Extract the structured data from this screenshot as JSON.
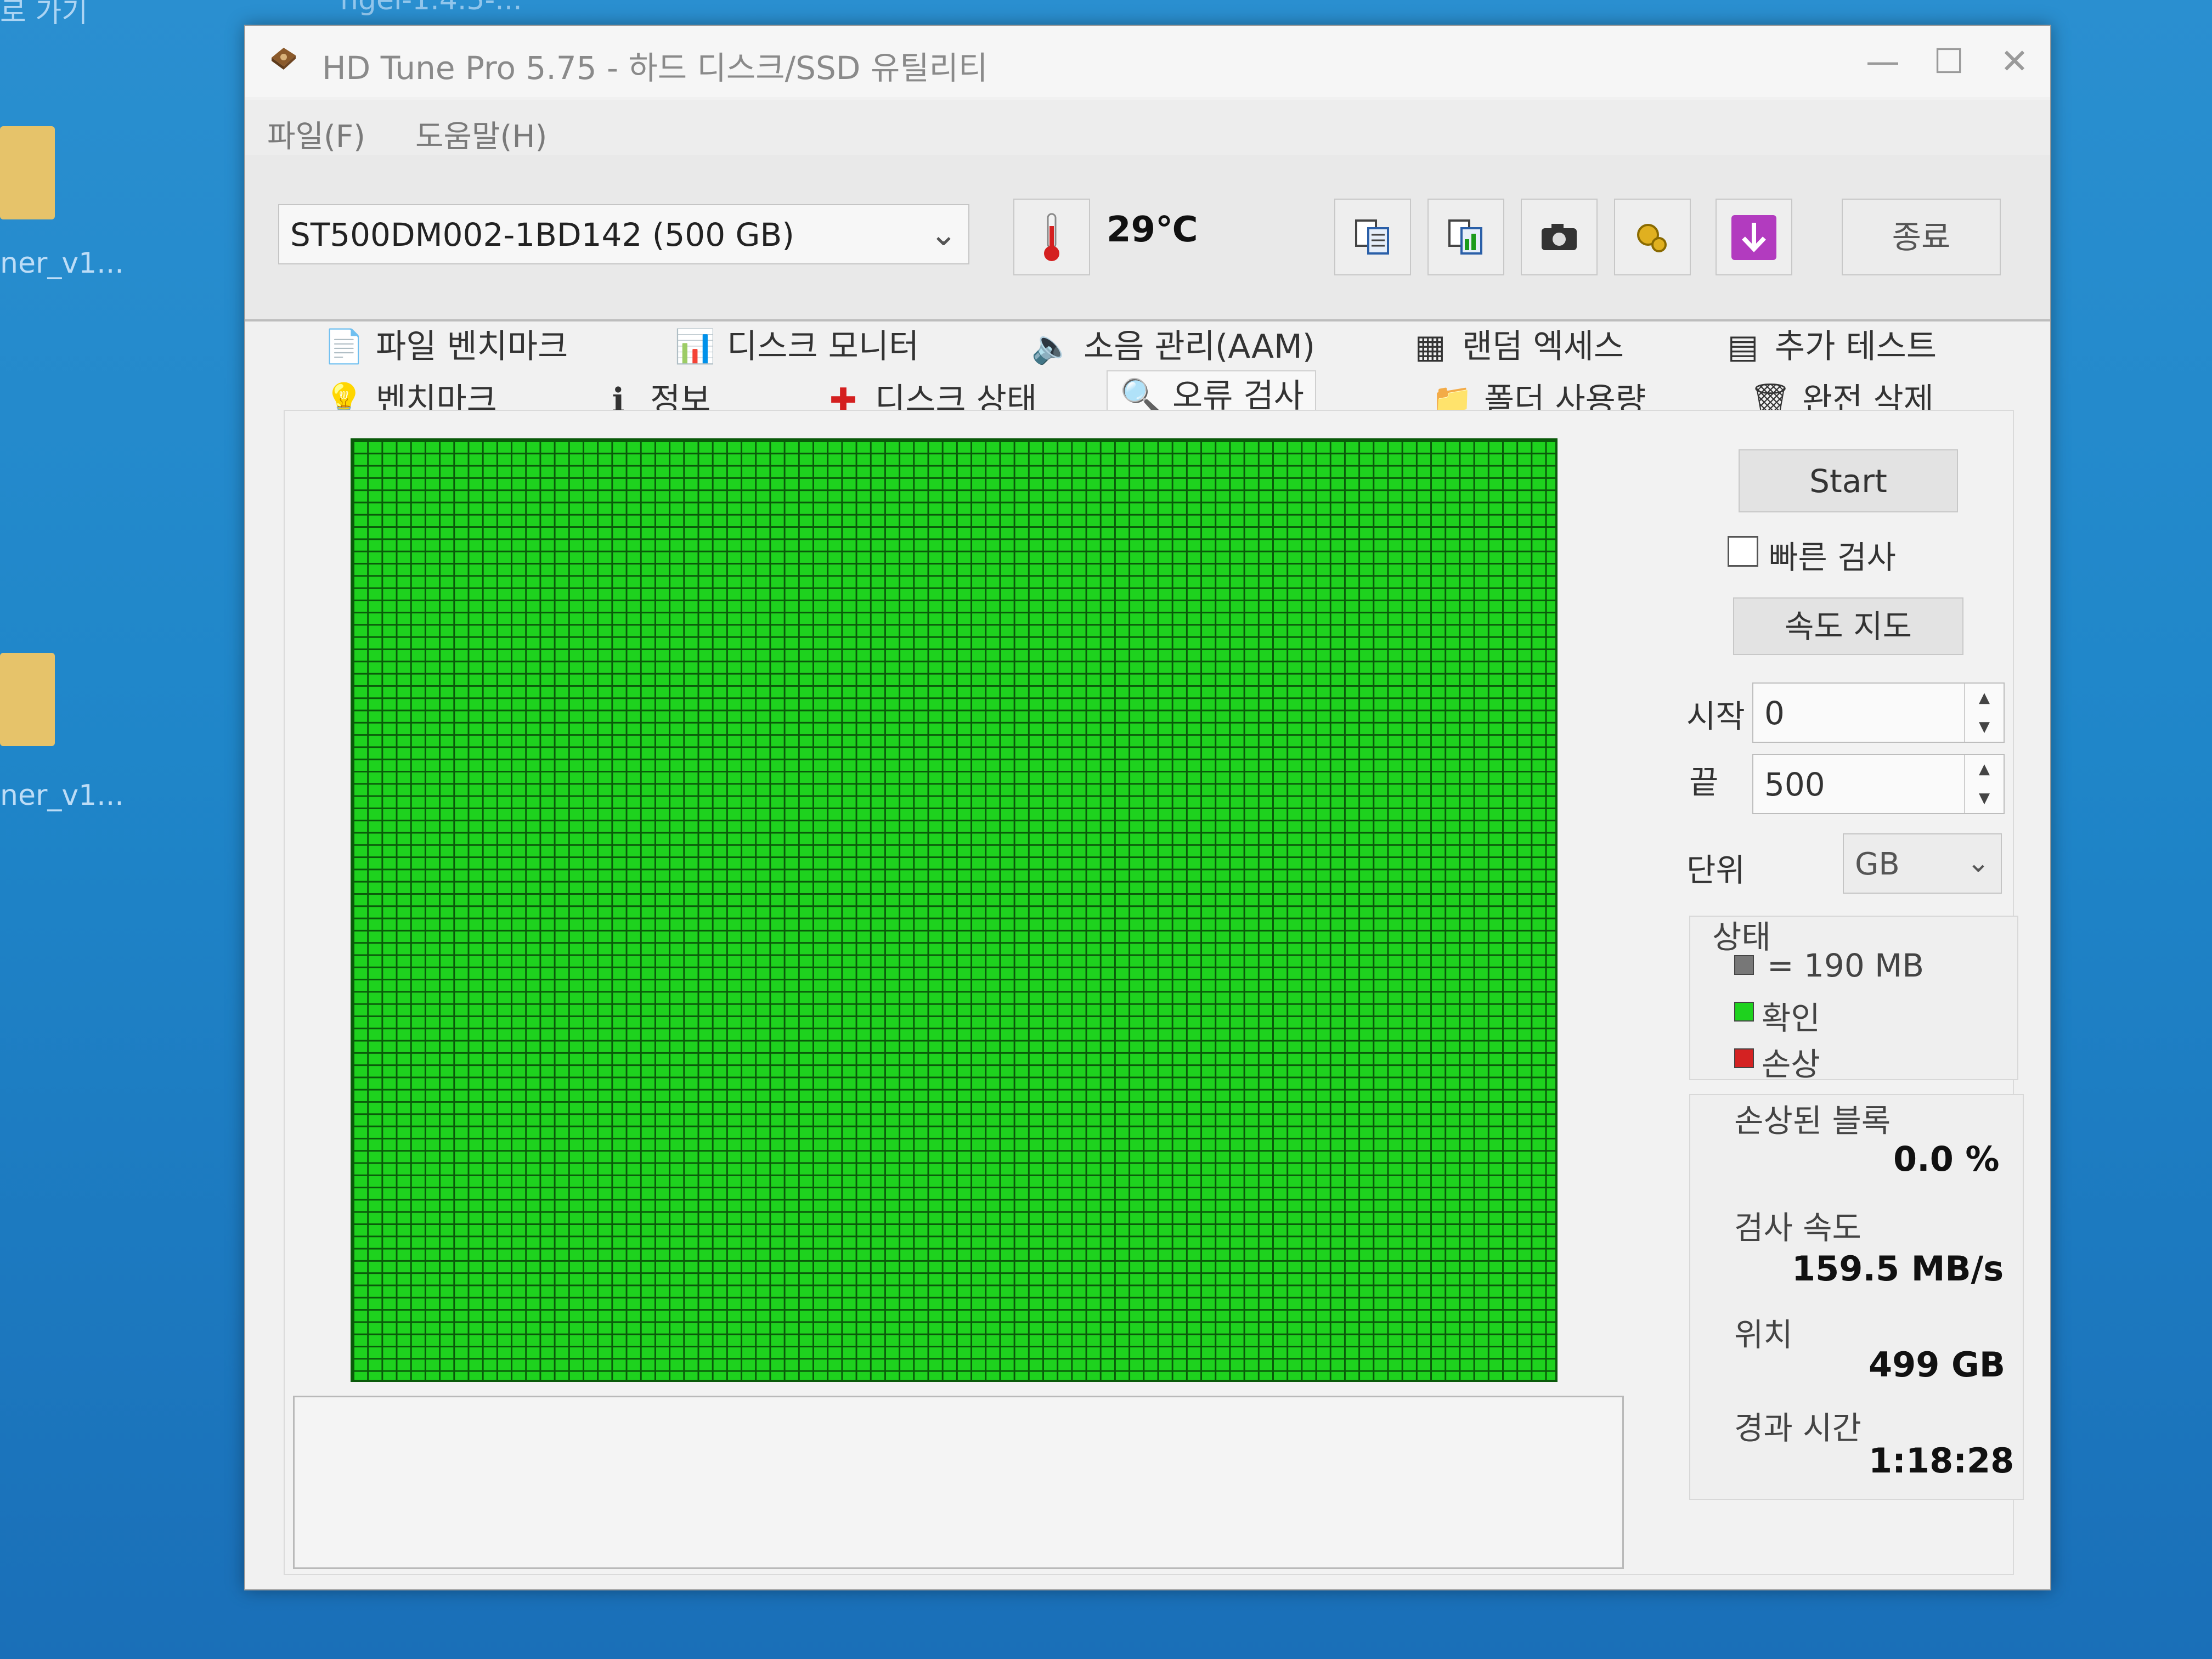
{
  "desktop": {
    "top_left_label": "로 가기",
    "top_center_label": "ngel-1.4.5-...",
    "icon_labels": [
      "ner_v1...",
      "ner_v1..."
    ]
  },
  "window": {
    "title": "HD Tune Pro 5.75 - 하드 디스크/SSD 유틸리티",
    "controls": {
      "minimize": "—",
      "maximize": "☐",
      "close": "✕"
    }
  },
  "menu": {
    "file": "파일(F)",
    "help": "도움말(H)"
  },
  "toolbar": {
    "drive": "ST500DM002-1BD142 (500 GB)",
    "temperature": "29℃",
    "exit_label": "종료",
    "icons": [
      "copy-text-icon",
      "copy-screenshot-icon",
      "camera-icon",
      "options-icon",
      "save-download-icon"
    ]
  },
  "tabs": {
    "row1": [
      "파일 벤치마크",
      "디스크 모니터",
      "소음 관리(AAM)",
      "랜덤 엑세스",
      "추가 테스트"
    ],
    "row2": [
      "벤치마크",
      "정보",
      "디스크 상태",
      "오류 검사",
      "폴더 사용량",
      "완전 삭제"
    ],
    "active": "오류 검사"
  },
  "error_scan": {
    "start_label": "Start",
    "quick_scan_label": "빠른 검사",
    "quick_scan_checked": false,
    "speed_map_label": "속도 지도",
    "start_field_label": "시작",
    "start_value": "0",
    "end_field_label": "끝",
    "end_value": "500",
    "unit_label": "단위",
    "unit_value": "GB",
    "legend": {
      "title": "상태",
      "block_size": "= 190 MB",
      "ok": "확인",
      "damaged": "손상",
      "colors": {
        "block": "#777777",
        "ok": "#1ed21e",
        "damaged": "#d42222"
      }
    },
    "stats": {
      "damaged_blocks_label": "손상된 블록",
      "damaged_blocks_value": "0.0 %",
      "scan_speed_label": "검사 속도",
      "scan_speed_value": "159.5 MB/s",
      "position_label": "위치",
      "position_value": "499 GB",
      "elapsed_label": "경과 시간",
      "elapsed_value": "1:18:28"
    },
    "block_map_status": "all-ok"
  }
}
